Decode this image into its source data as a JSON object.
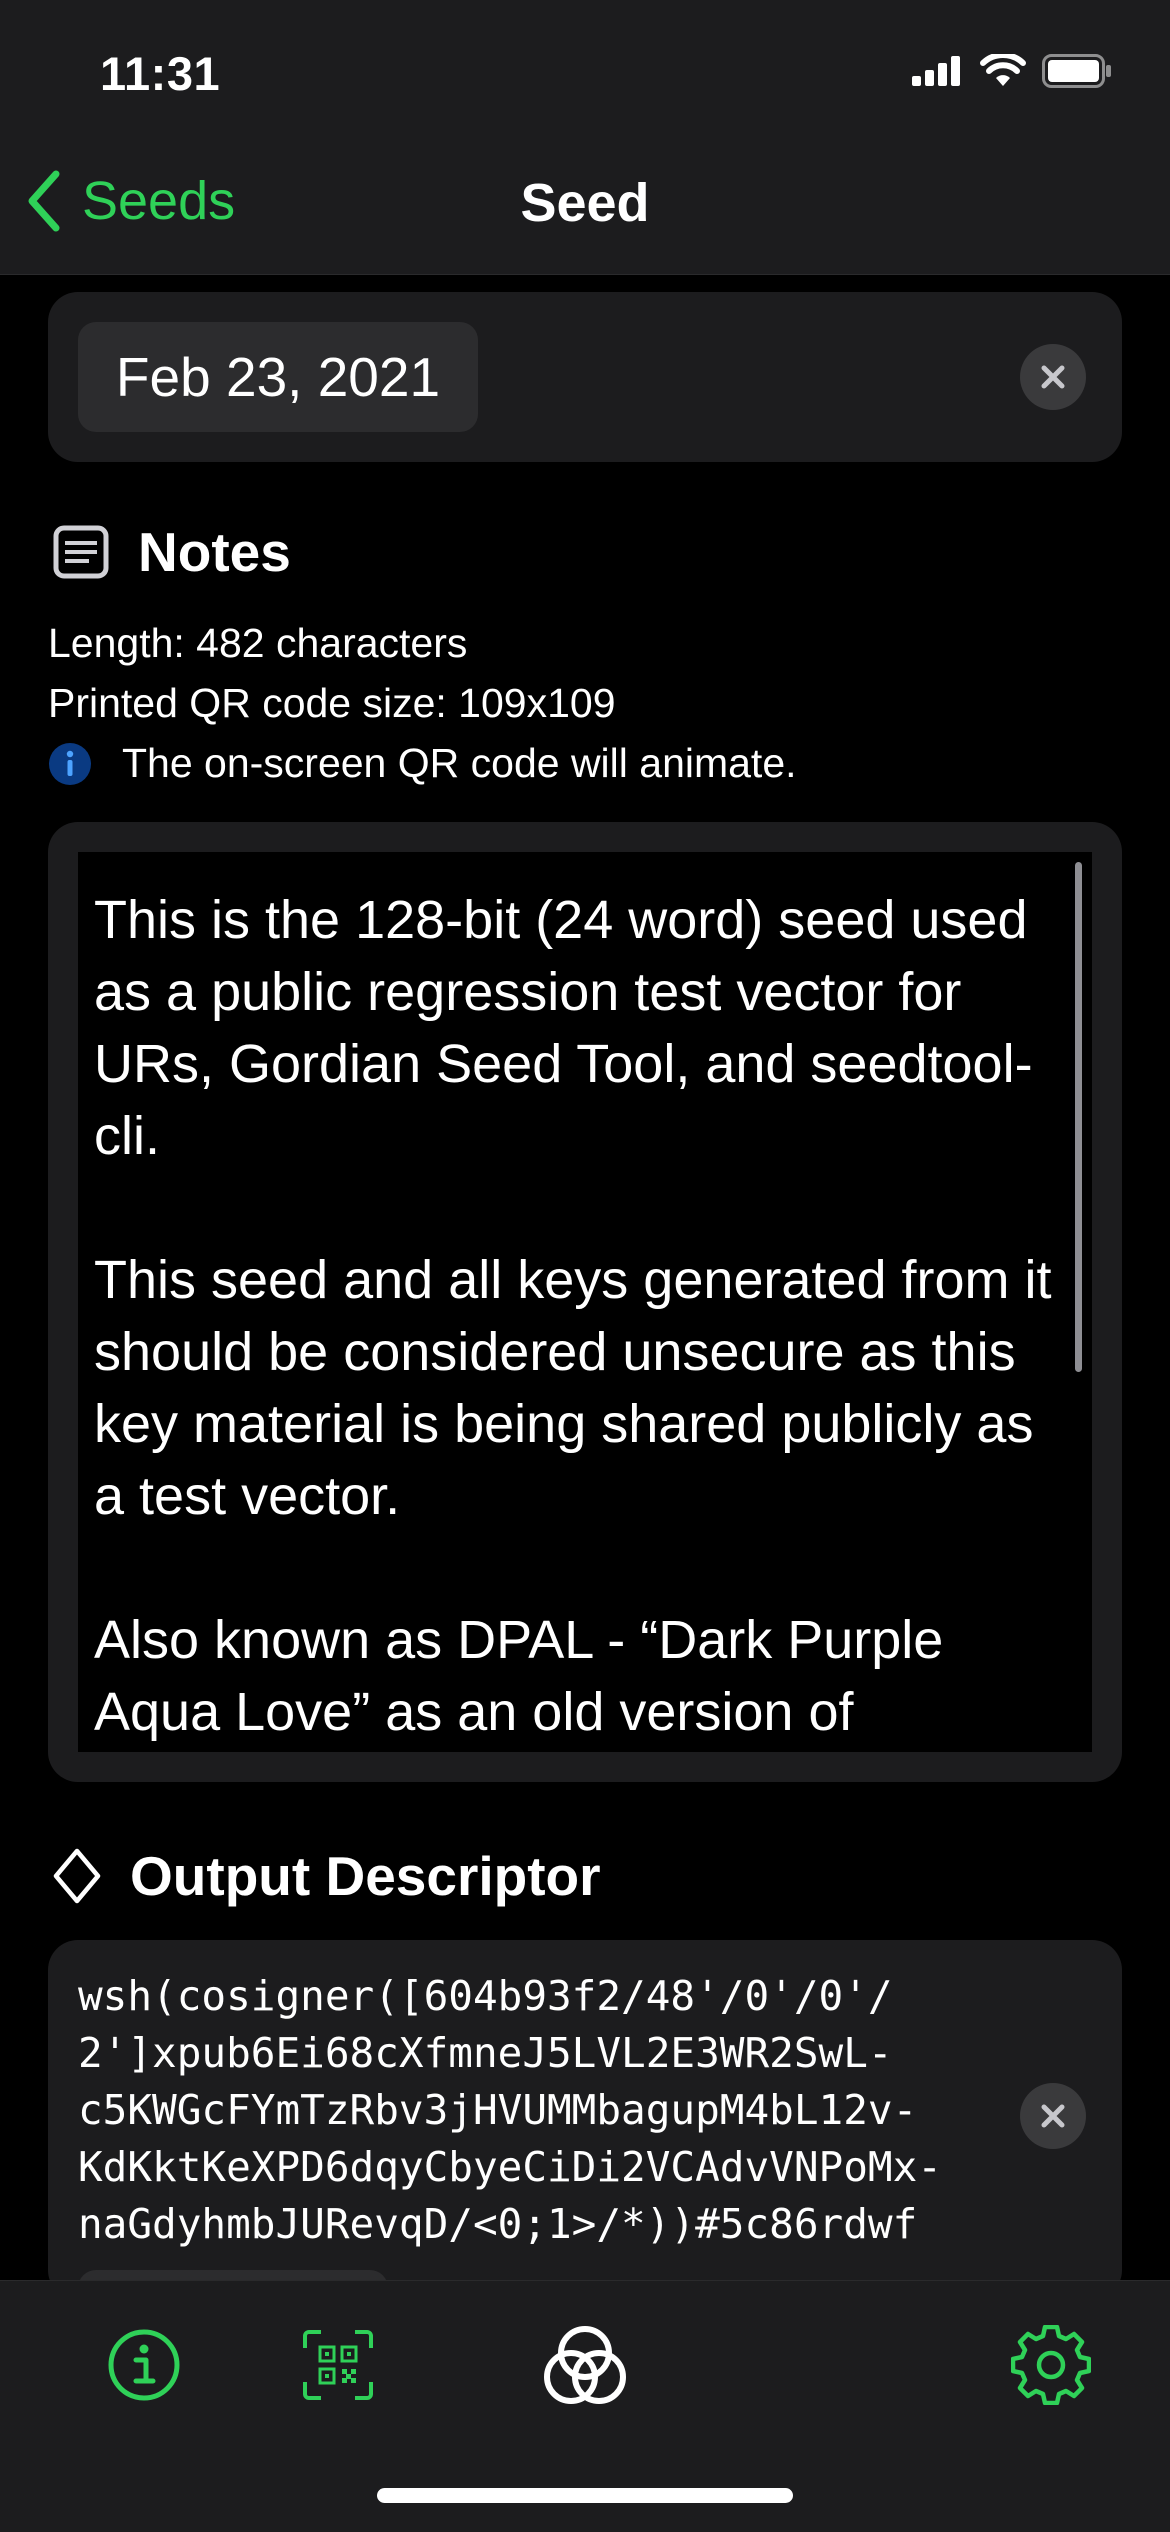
{
  "status_bar": {
    "time": "11:31"
  },
  "nav": {
    "back_label": "Seeds",
    "title": "Seed"
  },
  "date_field": {
    "value": "Feb 23, 2021"
  },
  "notes": {
    "heading": "Notes",
    "length_text": "Length: 482 characters",
    "qr_size_text": "Printed QR code size: 109x109",
    "info_text": "The on-screen QR code will animate.",
    "body": "This is the 128-bit (24 word) seed used as a public regression test vector for URs, Gordian Seed Tool, and seedtool-cli.\n\nThis seed and all keys generated from it should be considered unsecure as this key material is being shared publicly as a test vector.\n\nAlso known as DPAL - “Dark Purple Aqua Love” as an old version of"
  },
  "output_descriptor": {
    "heading": "Output Descriptor",
    "lines": [
      "wsh(cosigner([604b93f2/48'/0'/0'/",
      "2']xpub6Ei68cXfmneJ5LVL2E3WR2SwL-",
      "c5KWGcFYmTzRbv3jHVUMMbagupM4bL12v-",
      "KdKktKeXPD6dqyCbyeCiDi2VCAdvVNPoMx-",
      "naGdyhmbJURevqD/<0;1>/*))#5c86rdwf"
    ]
  },
  "colors": {
    "accent_green": "#2fd158",
    "info_blue": "#0a84ff",
    "card_bg": "#1c1c1e",
    "chrome_bg": "#1c1c1e"
  },
  "icons": {
    "back": "chevron-left-icon",
    "notes": "notes-icon",
    "info": "info-circle-icon",
    "descriptor": "diamond-icon",
    "clear": "close-icon",
    "toolbar": [
      "info-icon",
      "qr-scan-icon",
      "app-logo-icon",
      "gear-icon"
    ]
  }
}
